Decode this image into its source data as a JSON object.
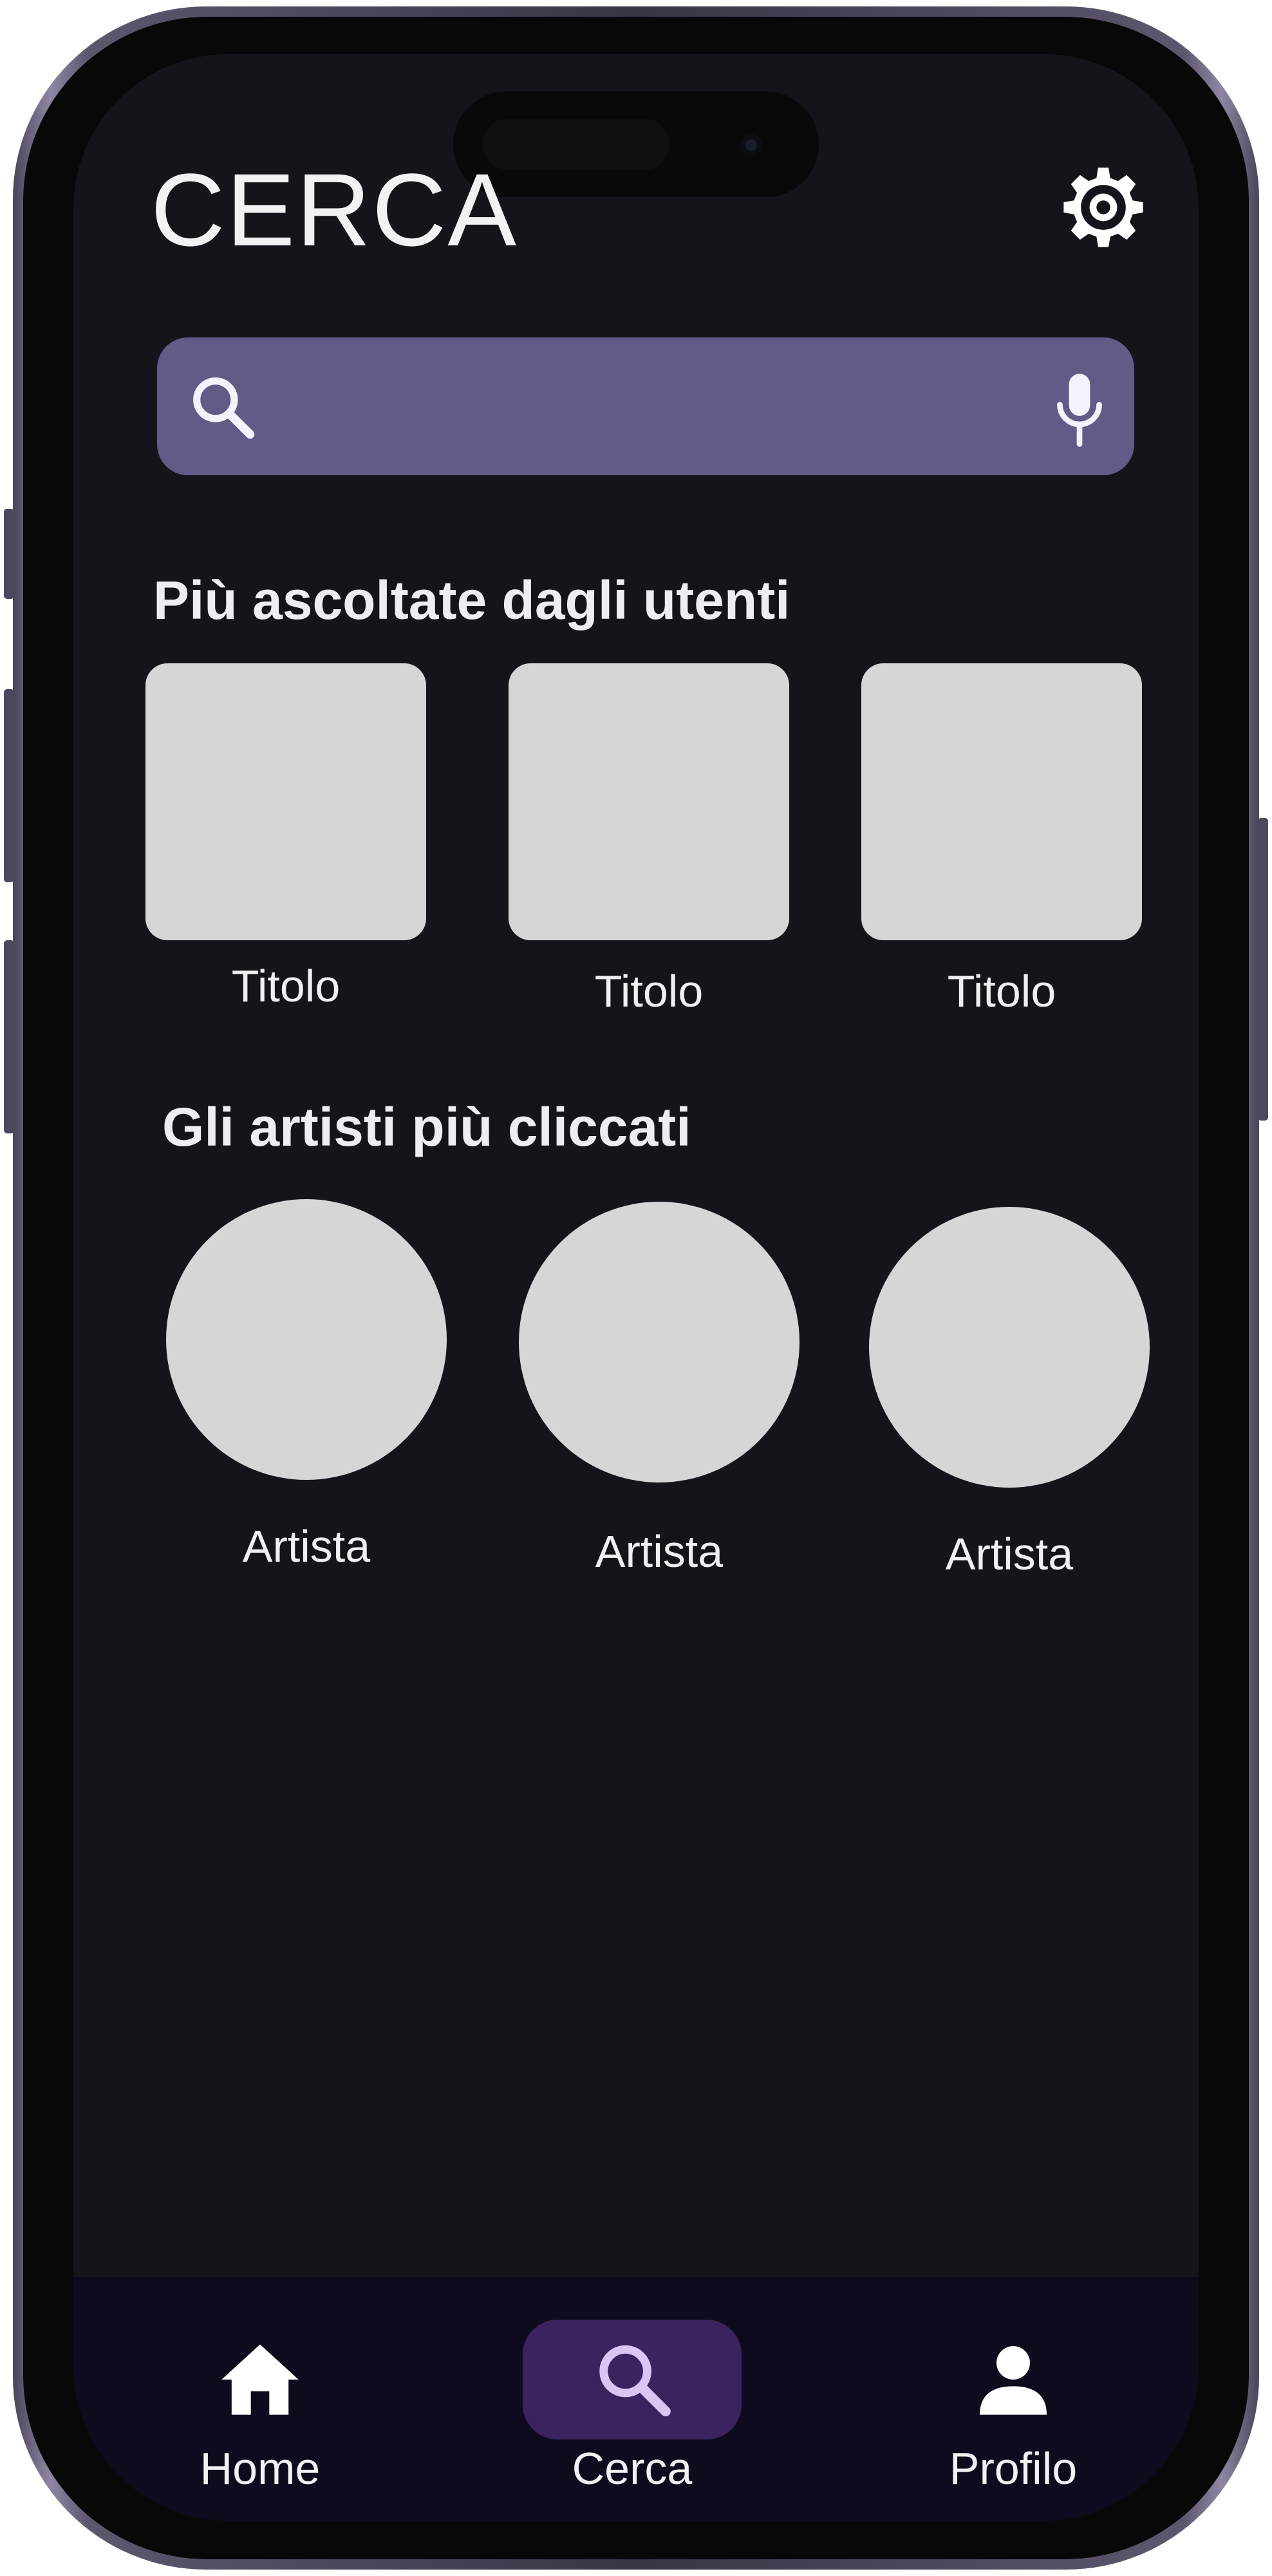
{
  "header": {
    "title": "CERCA",
    "settings_icon": "gear-icon"
  },
  "search": {
    "value": "",
    "placeholder": "",
    "search_icon": "search-icon",
    "mic_icon": "microphone-icon"
  },
  "sections": {
    "most_listened": {
      "title": "Più ascoltate dagli utenti",
      "items": [
        {
          "label": "Titolo"
        },
        {
          "label": "Titolo"
        },
        {
          "label": "Titolo"
        }
      ]
    },
    "top_artists": {
      "title": "Gli artisti più cliccati",
      "items": [
        {
          "label": "Artista"
        },
        {
          "label": "Artista"
        },
        {
          "label": "Artista"
        }
      ]
    }
  },
  "nav": {
    "items": [
      {
        "label": "Home",
        "icon": "home-icon",
        "active": false
      },
      {
        "label": "Cerca",
        "icon": "search-icon",
        "active": true
      },
      {
        "label": "Profilo",
        "icon": "user-icon",
        "active": false
      }
    ]
  },
  "colors": {
    "screen_background": "#14141b",
    "search_bar": "#625a87",
    "placeholder_tile": "#d6d6d6",
    "nav_background": "#0e0b1f",
    "nav_active_pill": "#3b2360",
    "nav_active_icon": "#d9c6f5"
  }
}
